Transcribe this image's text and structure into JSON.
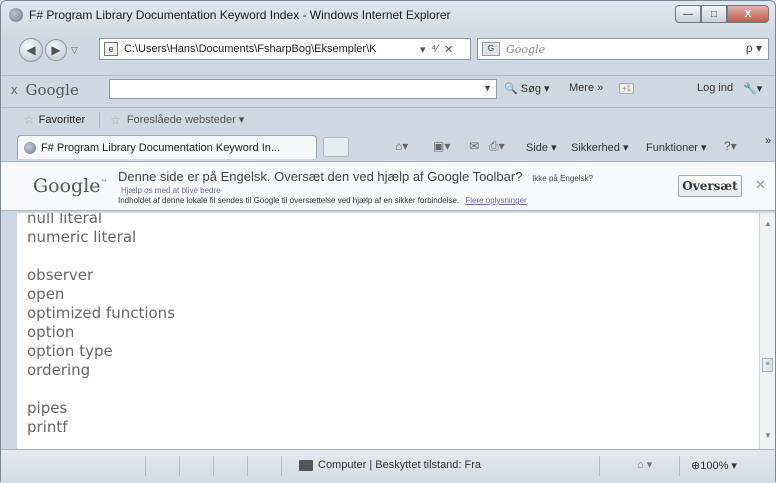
{
  "window": {
    "title": "F# Program Library Documentation Keyword Index - Windows Internet Explorer",
    "buttons": {
      "minimize": "—",
      "maximize": "□",
      "close": "X"
    }
  },
  "address_bar": {
    "url": "C:\\Users\\Hans\\Documents\\FsharpBog\\Eksempler\\K",
    "refresh_icon": "⁴⁄",
    "stop_icon": "✕",
    "search_placeholder": "Google",
    "search_go_icon": "ρ ▾"
  },
  "google_toolbar": {
    "close": "x",
    "logo": "Google",
    "search_label": "Søg",
    "more_label": "Mere »",
    "plus_badge": "+1",
    "login_label": "Log ind"
  },
  "favorites_bar": {
    "favorites_label": "Favoritter",
    "suggested_sites": "Foreslåede websteder ▾"
  },
  "tab": {
    "label": "F# Program Library Documentation Keyword In..."
  },
  "command_bar": {
    "side": "Side ▾",
    "sikkerhed": "Sikkerhed ▾",
    "funktioner": "Funktioner ▾",
    "more": "»"
  },
  "translate_bar": {
    "logo": "Google",
    "message": "Denne side er på Engelsk. Oversæt den ved hjælp af Google Toolbar?",
    "not_english": "Ikke på Engelsk?",
    "help": "Hjælp os med at blive bedre",
    "info": "Indholdet af denne lokale fil sendes til Google til oversættelse ved hjælp af en sikker forbindelse.",
    "more_info_link": "Flere oplysninger",
    "translate_button": "Oversæt",
    "close": "✕"
  },
  "content": {
    "keywords": [
      "null literal",
      "numeric literal",
      "",
      "observer",
      "open",
      "optimized functions",
      "option",
      "option type",
      "ordering",
      "",
      "pipes",
      "printf"
    ]
  },
  "status_bar": {
    "zone": "Computer | Beskyttet tilstand: Fra",
    "zoom": "⊕100%  ▾"
  }
}
